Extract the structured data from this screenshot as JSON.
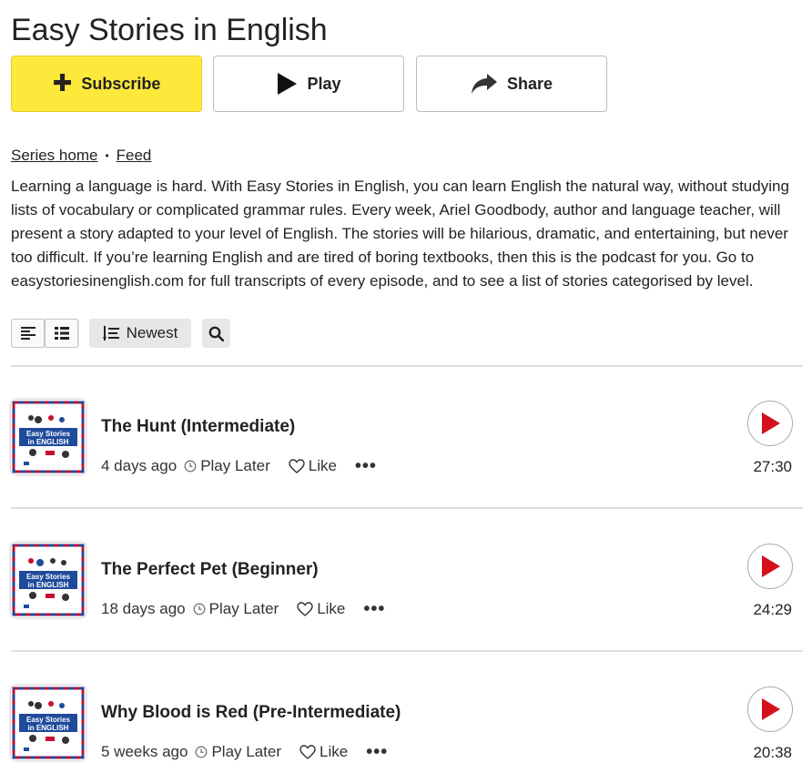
{
  "page": {
    "title": "Easy Stories in English"
  },
  "actions": {
    "subscribe": "Subscribe",
    "play": "Play",
    "share": "Share"
  },
  "breadcrumbs": {
    "series_home": "Series home",
    "separator": "•",
    "feed": "Feed"
  },
  "description": "Learning a language is hard. With Easy Stories in English, you can learn English the natural way, without studying lists of vocabulary or complicated grammar rules. Every week, Ariel Goodbody, author and language teacher, will present a story adapted to your level of English. The stories will be hilarious, dramatic, and entertaining, but never too difficult. If you’re learning English and are tired of boring textbooks, then this is the podcast for you. Go to easystoriesinenglish.com for full transcripts of every episode, and to see a list of stories categorised by level.",
  "toolbar": {
    "sort_label": "Newest"
  },
  "cover": {
    "line1": "Easy Stories",
    "line2": "in ENGLISH"
  },
  "episode_labels": {
    "play_later": "Play Later",
    "like": "Like",
    "more": "•••"
  },
  "episodes": [
    {
      "title": "The Hunt (Intermediate)",
      "age": "4 days ago",
      "duration": "27:30"
    },
    {
      "title": "The Perfect Pet (Beginner)",
      "age": "18 days ago",
      "duration": "24:29"
    },
    {
      "title": "Why Blood is Red (Pre-Intermediate)",
      "age": "5 weeks ago",
      "duration": "20:38"
    }
  ],
  "colors": {
    "subscribe_bg": "#fde83c",
    "play_red": "#d4111b",
    "cover_blue": "#1f4a9c"
  }
}
